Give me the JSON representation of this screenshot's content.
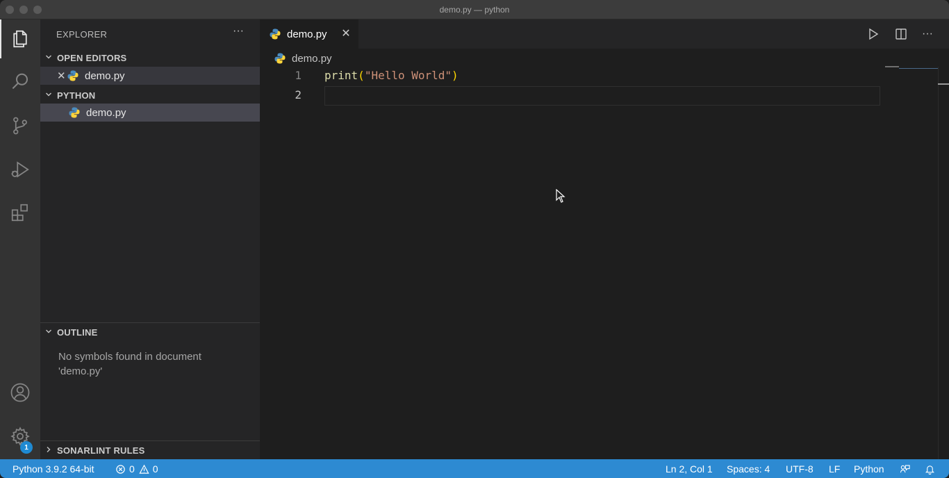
{
  "window": {
    "title": "demo.py — python"
  },
  "sidebar": {
    "title": "EXPLORER",
    "more_label": "···",
    "open_editors": {
      "label": "OPEN EDITORS",
      "items": [
        {
          "name": "demo.py"
        }
      ]
    },
    "folder": {
      "label": "PYTHON",
      "items": [
        {
          "name": "demo.py"
        }
      ]
    },
    "outline": {
      "label": "OUTLINE",
      "message": "No symbols found in document 'demo.py'"
    },
    "sonarlint": {
      "label": "SONARLINT RULES"
    }
  },
  "activity": {
    "settings_badge": "1"
  },
  "editor": {
    "tab": {
      "name": "demo.py",
      "close": "✕"
    },
    "breadcrumb": "demo.py",
    "more_label": "···",
    "lines": [
      {
        "number": "1",
        "fn": "print",
        "open": "(",
        "string": "\"Hello World\"",
        "close": ")"
      },
      {
        "number": "2"
      }
    ]
  },
  "statusbar": {
    "interpreter": "Python 3.9.2 64-bit",
    "errors": "0",
    "warnings": "0",
    "position": "Ln 2, Col 1",
    "spaces": "Spaces: 4",
    "encoding": "UTF-8",
    "eol": "LF",
    "language": "Python"
  },
  "colors": {
    "statusbar": "#2d8ad2",
    "activity_bar": "#333333",
    "sidebar": "#252526",
    "editor": "#1e1e1e"
  }
}
